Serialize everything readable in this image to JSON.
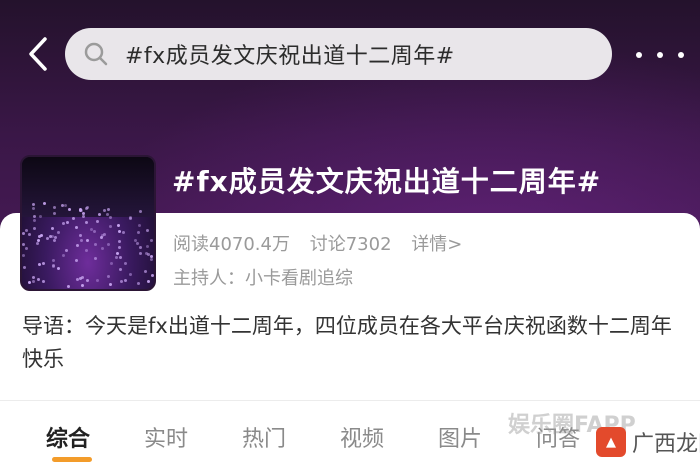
{
  "search": {
    "query": "#fx成员发文庆祝出道十二周年#"
  },
  "topic": {
    "title": "#fx成员发文庆祝出道十二周年#",
    "reads": "阅读4070.4万",
    "discussions": "讨论7302",
    "details_link": "详情>",
    "host": "主持人：小卡看剧追综",
    "intro": "导语：今天是fx出道十二周年，四位成员在各大平台庆祝函数十二周年快乐"
  },
  "tabs": [
    {
      "label": "综合",
      "active": true
    },
    {
      "label": "实时"
    },
    {
      "label": "热门"
    },
    {
      "label": "视频"
    },
    {
      "label": "图片"
    },
    {
      "label": "问答"
    }
  ],
  "watermark": {
    "text": "娱乐圈FAPP",
    "site": "广西龙网"
  },
  "colors": {
    "accent": "#f39c2a",
    "hero": "#3a1747"
  },
  "icons": [
    "back-arrow-icon",
    "search-icon",
    "more-dots-icon"
  ]
}
